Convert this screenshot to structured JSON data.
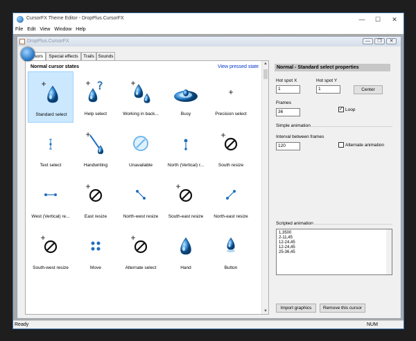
{
  "window": {
    "title": "CursorFX Theme Editor - DropPlus.CursorFX",
    "controls": {
      "minimize": "—",
      "maximize": "☐",
      "close": "✕"
    }
  },
  "menu": [
    "File",
    "Edit",
    "View",
    "Window",
    "Help"
  ],
  "child": {
    "title": "DropPlus.CursorFX",
    "buttons": {
      "min": "—",
      "max": "❐",
      "close": "✕"
    }
  },
  "tabs": [
    "Cursors",
    "Special effects",
    "Trails",
    "Sounds"
  ],
  "left_panel": {
    "heading": "Normal cursor states",
    "link": "View pressed state",
    "cursors": [
      {
        "label": "Standard select",
        "icon": "drop-arrow-icon",
        "selected": true
      },
      {
        "label": "Help select",
        "icon": "drop-help-icon"
      },
      {
        "label": "Working in back...",
        "icon": "drop-working-icon"
      },
      {
        "label": "Busy",
        "icon": "drop-splash-icon"
      },
      {
        "label": "Precision select",
        "icon": "crosshair-icon"
      },
      {
        "label": "Text select",
        "icon": "text-beam-icon"
      },
      {
        "label": "Handwriting",
        "icon": "pen-drop-icon"
      },
      {
        "label": "Unavailable",
        "icon": "unavailable-ring-icon"
      },
      {
        "label": "North (Vertical) r...",
        "icon": "vertical-resize-icon"
      },
      {
        "label": "South resize",
        "icon": "no-sign-icon"
      },
      {
        "label": "West (Vertical) re...",
        "icon": "horizontal-resize-icon"
      },
      {
        "label": "East resize",
        "icon": "no-sign-icon"
      },
      {
        "label": "North-west resize",
        "icon": "diagonal-nw-resize-icon"
      },
      {
        "label": "South-east resize",
        "icon": "no-sign-icon"
      },
      {
        "label": "North-east resize",
        "icon": "diagonal-ne-resize-icon"
      },
      {
        "label": "South-west resize",
        "icon": "no-sign-icon"
      },
      {
        "label": "Move",
        "icon": "move-icon"
      },
      {
        "label": "Alternate select",
        "icon": "no-sign-icon"
      },
      {
        "label": "Hand",
        "icon": "drop-hand-icon"
      },
      {
        "label": "Button",
        "icon": "drop-button-icon"
      }
    ]
  },
  "right_panel": {
    "heading": "Normal - Standard select properties",
    "hotspot_x_label": "Hot spot X",
    "hotspot_x_value": "1",
    "hotspot_y_label": "Hot spot Y",
    "hotspot_y_value": "1",
    "center_button": "Center",
    "frames_label": "Frames",
    "frames_value": "36",
    "loop_label": "Loop",
    "loop_checked": true,
    "simple_animation_label": "Simple animation",
    "interval_label": "Interval between frames",
    "interval_value": "120",
    "alternate_label": "Alternate animation",
    "alternate_checked": false,
    "scripted_label": "Scripted animation",
    "scripted_lines": [
      "1,3500",
      "2-11,45",
      "12-24,45",
      "12-24,45",
      "25-36,45"
    ],
    "import_button": "Import graphics",
    "remove_button": "Remove this cursor"
  },
  "status": {
    "left": "Ready",
    "right": "NUM"
  },
  "colors": {
    "accent": "#1f6fbf",
    "selection": "#cce8ff",
    "link": "#0033cc"
  }
}
